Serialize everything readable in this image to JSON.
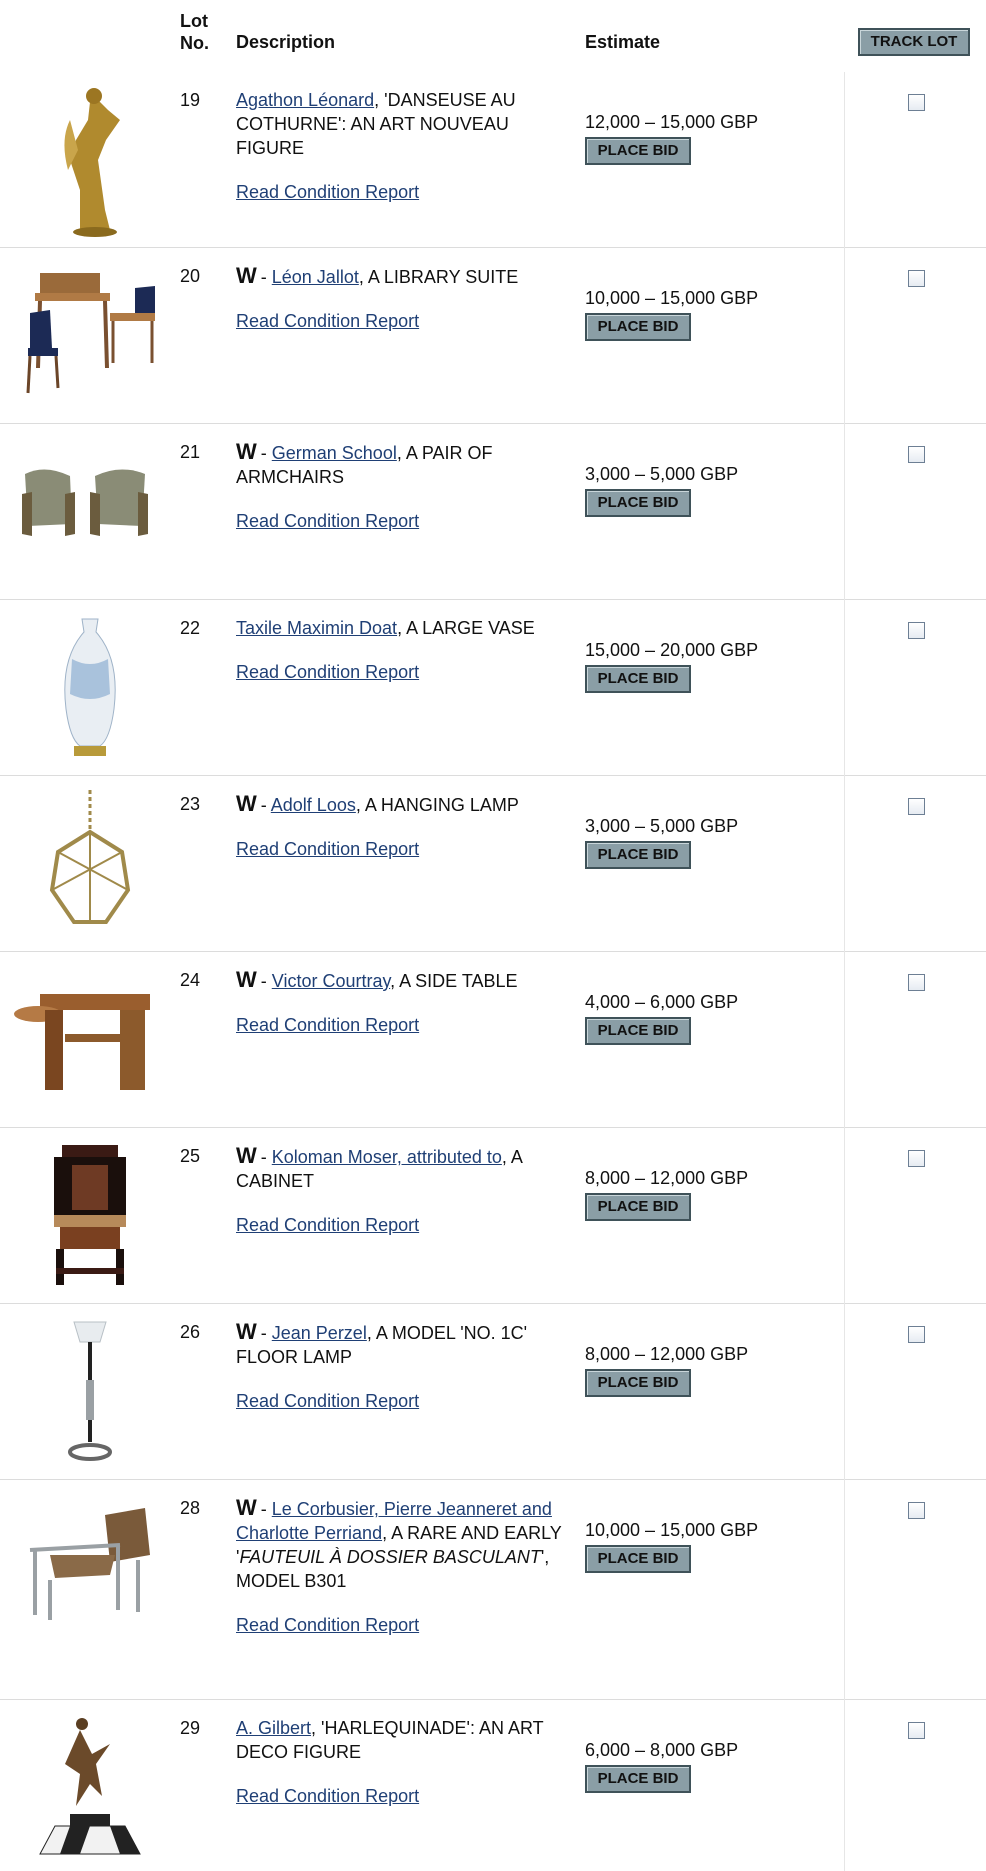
{
  "header": {
    "lot_no": "Lot\nNo.",
    "description": "Description",
    "estimate": "Estimate",
    "track_lot": "TRACK LOT"
  },
  "common": {
    "condition_report": "Read Condition Report",
    "place_bid": "PLACE BID",
    "w_mark": "W",
    "w_sep": " - "
  },
  "lots": [
    {
      "lot": "19",
      "w": false,
      "link": "Agathon Léonard",
      "rest": ", 'DANSEUSE AU COTHURNE': AN ART NOUVEAU FIGURE",
      "estimate": "12,000 – 15,000 GBP",
      "image_icon": "gilt-dancer-figure"
    },
    {
      "lot": "20",
      "w": true,
      "link": "Léon Jallot",
      "rest": ", A LIBRARY SUITE",
      "estimate": "10,000 – 15,000 GBP",
      "image_icon": "desk-and-chairs"
    },
    {
      "lot": "21",
      "w": true,
      "link": "German School",
      "rest": ", A PAIR OF ARMCHAIRS",
      "estimate": "3,000 – 5,000 GBP",
      "image_icon": "pair-of-armchairs"
    },
    {
      "lot": "22",
      "w": false,
      "link": "Taxile Maximin Doat",
      "rest": ", A LARGE VASE",
      "estimate": "15,000 – 20,000 GBP",
      "image_icon": "porcelain-vase"
    },
    {
      "lot": "23",
      "w": true,
      "link": "Adolf Loos",
      "rest": ", A HANGING LAMP",
      "estimate": "3,000 – 5,000 GBP",
      "image_icon": "hanging-lamp"
    },
    {
      "lot": "24",
      "w": true,
      "link": "Victor Courtray",
      "rest": ", A SIDE TABLE",
      "estimate": "4,000 – 6,000 GBP",
      "image_icon": "side-table"
    },
    {
      "lot": "25",
      "w": true,
      "link": "Koloman Moser, attributed to",
      "rest": ", A CABINET",
      "estimate": "8,000 – 12,000 GBP",
      "image_icon": "cabinet"
    },
    {
      "lot": "26",
      "w": true,
      "link": "Jean Perzel",
      "rest": ", A MODEL 'NO. 1C' FLOOR LAMP",
      "estimate": "8,000 – 12,000 GBP",
      "image_icon": "floor-lamp"
    },
    {
      "lot": "28",
      "w": true,
      "link": "Le Corbusier, Pierre Jeanneret and Charlotte Perriand",
      "rest_a": ", A RARE AND EARLY '",
      "rest_i": "FAUTEUIL À DOSSIER BASCULANT",
      "rest_b": "', MODEL B301",
      "estimate": "10,000 – 15,000 GBP",
      "image_icon": "lounge-chair"
    },
    {
      "lot": "29",
      "w": false,
      "link": "A. Gilbert",
      "rest": ", 'HARLEQUINADE': AN ART DECO FIGURE",
      "estimate": "6,000 – 8,000 GBP",
      "image_icon": "dancer-figure-on-base"
    }
  ]
}
